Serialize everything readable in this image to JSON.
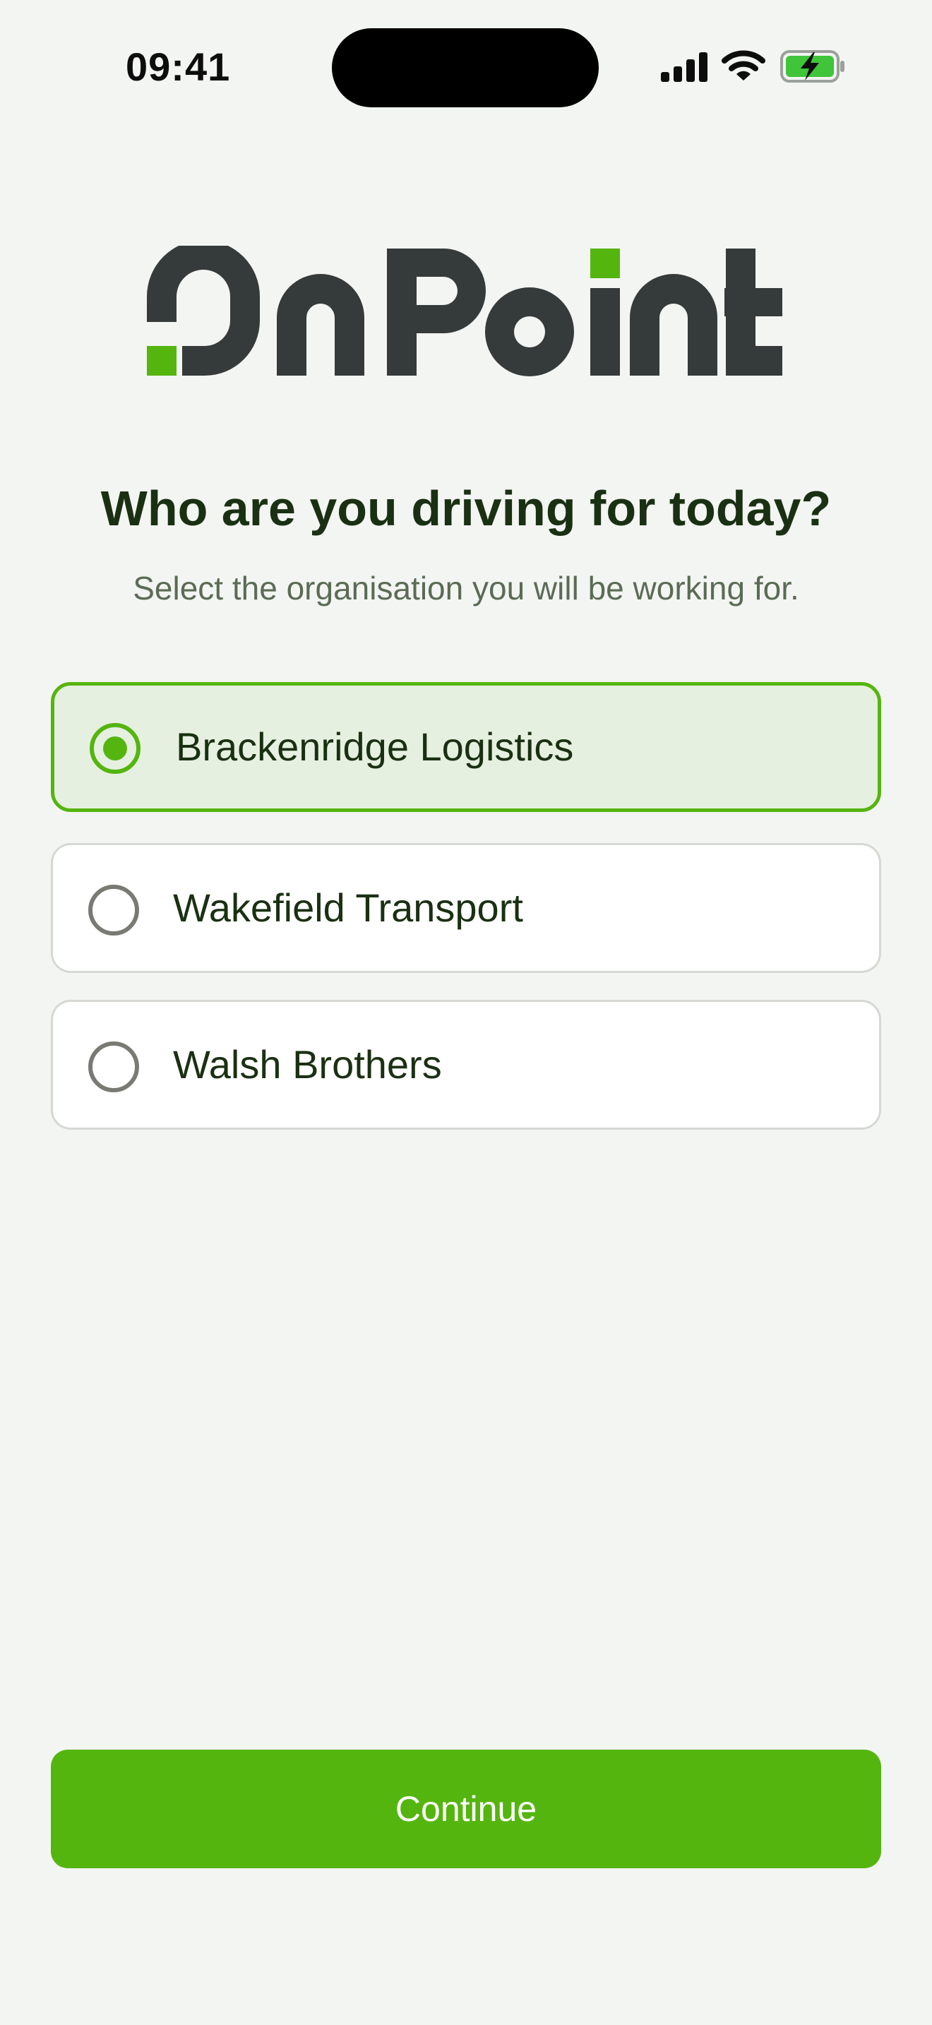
{
  "status_bar": {
    "time": "09:41",
    "icons": [
      "signal-bars-icon",
      "wifi-icon",
      "battery-charging-icon"
    ],
    "battery_color": "#3fc43a"
  },
  "logo": {
    "text": "OnPoint",
    "dark_color": "#353a3a",
    "accent_color": "#55b50f"
  },
  "heading": {
    "title": "Who are you driving for today?",
    "subtitle": "Select the organisation you will be working for."
  },
  "organisations": [
    {
      "label": "Brackenridge Logistics",
      "selected": true
    },
    {
      "label": "Wakefield Transport",
      "selected": false
    },
    {
      "label": "Walsh Brothers",
      "selected": false
    }
  ],
  "continue_label": "Continue",
  "colors": {
    "accent": "#55b50f",
    "background": "#f3f5f2",
    "text": "#1a3012",
    "muted_text": "#5b6b55",
    "selected_background": "#e6f0e0"
  }
}
